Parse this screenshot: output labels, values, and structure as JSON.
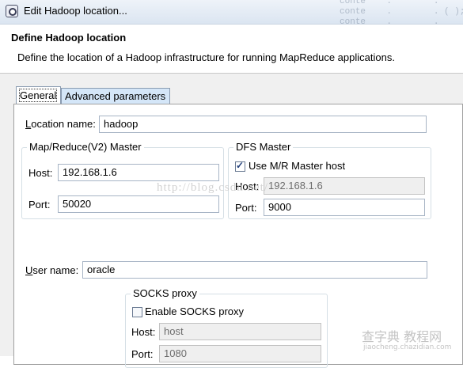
{
  "window": {
    "title": "Edit Hadoop location...",
    "background_code": "               conte    .        .         \n               conte    .        . ( );\n               conte    .        .      "
  },
  "header": {
    "title": "Define Hadoop location",
    "description": "Define the location of a Hadoop infrastructure for running MapReduce applications."
  },
  "tabs": [
    {
      "label": "General",
      "active": true
    },
    {
      "label": "Advanced parameters",
      "active": false
    }
  ],
  "general": {
    "location_name": {
      "prefix": "L",
      "label_rest": "ocation name:",
      "value": "hadoop"
    },
    "mapreduce_master": {
      "legend": "Map/Reduce(V2) Master",
      "host_label": "Host:",
      "host_value": "192.168.1.6",
      "port_label": "Port:",
      "port_value": "50020"
    },
    "dfs_master": {
      "legend": "DFS Master",
      "use_mr_label": "Use M/R Master host",
      "use_mr_checked": true,
      "host_label": "Host:",
      "host_value": "192.168.1.6",
      "port_label": "Port:",
      "port_value": "9000"
    },
    "user_name": {
      "prefix": "U",
      "label_rest": "ser name:",
      "value": "oracle"
    },
    "socks_proxy": {
      "legend": "SOCKS proxy",
      "enable_label": "Enable SOCKS proxy",
      "enable_checked": false,
      "host_label": "Host:",
      "host_value": "host",
      "port_label": "Port:",
      "port_value": "1080"
    }
  },
  "watermarks": {
    "blog": "http://blog.csdn.net/",
    "site_name": "查字典 教程网",
    "site_url": "jiaocheng.chazidian.com"
  },
  "colors": {
    "tab_inactive": "#d4e6f8",
    "input_border": "#a7b4c5",
    "disabled_bg": "#efefef"
  }
}
